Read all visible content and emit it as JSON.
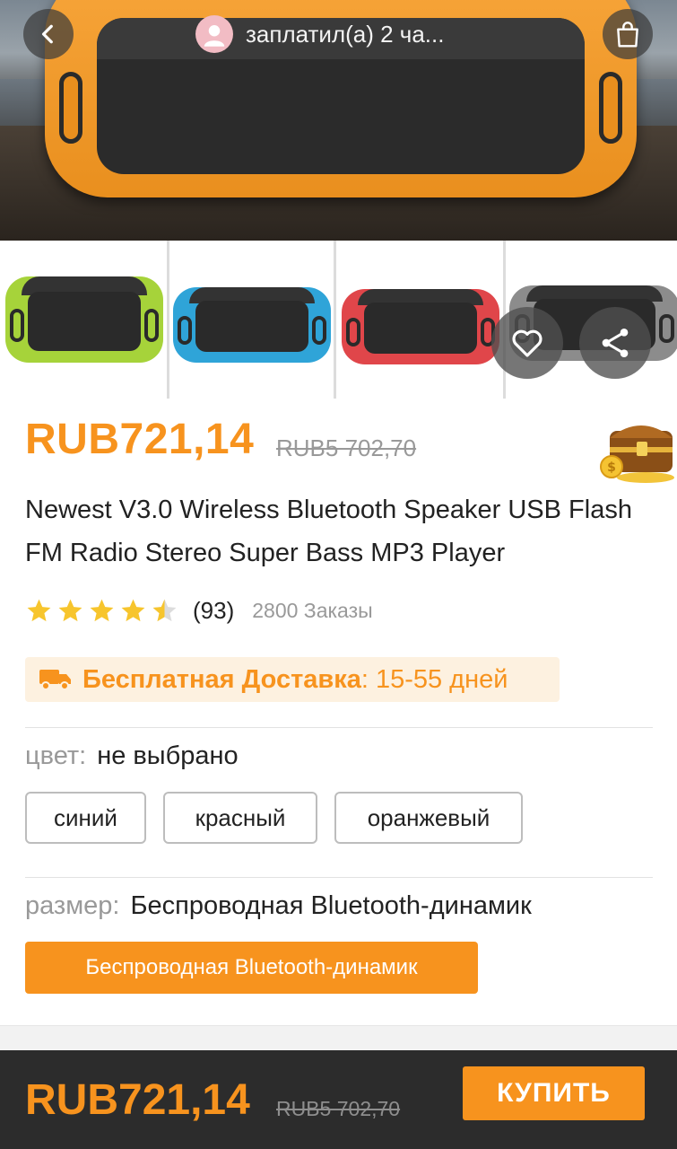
{
  "header": {
    "notice_text": "заплатил(а) 2 ча...",
    "back_icon": "chevron-left-icon",
    "cart_icon": "shopping-bag-icon"
  },
  "gallery": {
    "thumbnail_colors": [
      "#a6d33a",
      "#2fa4d8",
      "#e0464a",
      "#8c8c8c"
    ],
    "hero_color": "#f7a53a"
  },
  "product": {
    "price": "RUB721,14",
    "old_price": "RUB5 702,70",
    "title": "Newest V3.0 Wireless Bluetooth Speaker USB Flash FM Radio Stereo Super Bass MP3 Player",
    "rating_value": 4.5,
    "rating_max": 5,
    "review_count": "(93)",
    "orders": "2800 Заказы"
  },
  "shipping": {
    "label": "Бесплатная Доставка",
    "colon": ":",
    "days": "15-55 дней"
  },
  "options": {
    "color": {
      "key": "цвет:",
      "value": "не выбрано",
      "choices": [
        "синий",
        "красный",
        "оранжевый"
      ]
    },
    "size": {
      "key": "размер:",
      "value": "Беспроводная Bluetooth-динамик",
      "choices": [
        "Беспроводная Bluetooth-динамик"
      ]
    }
  },
  "bottom_bar": {
    "price": "RUB721,14",
    "old_price": "RUB5 702,70",
    "buy_label": "КУПИТЬ"
  },
  "colors": {
    "accent": "#f7931e",
    "shipping_bg": "#fdf1e0",
    "bottom_bar_bg": "#2c2c2c"
  }
}
